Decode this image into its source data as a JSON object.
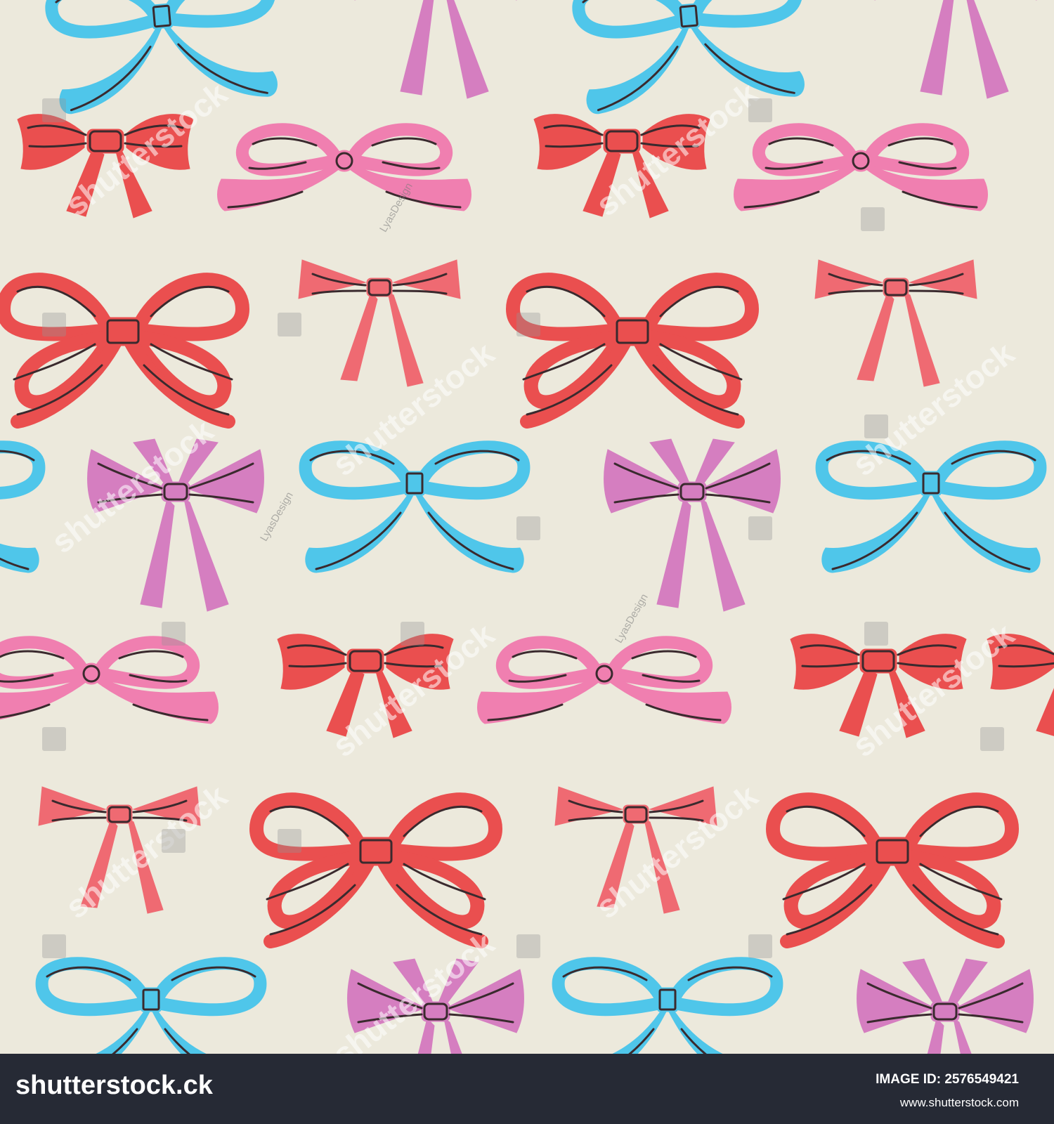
{
  "image": {
    "subject": "seamless pattern of hand-drawn ribbon bows",
    "background_color": "#ece9dc",
    "outline_color": "#3a2a2e",
    "palette": {
      "red": "#ea4f4f",
      "pink": "#f07fb0",
      "coral": "#ef6a72",
      "purple": "#d57ec0",
      "blue": "#4fc6ea"
    },
    "bow_styles": [
      "solid-bow",
      "open-loop-bow",
      "simple-bow",
      "double-loop-bow",
      "oval-loop-bow",
      "pinwheel-bow"
    ]
  },
  "watermark": {
    "text": "shutterstock",
    "author": "LyasDesign"
  },
  "footer": {
    "brand": "shutterstock.ck",
    "image_id": "IMAGE ID: 2576549421",
    "site": "www.shutterstock.com"
  }
}
